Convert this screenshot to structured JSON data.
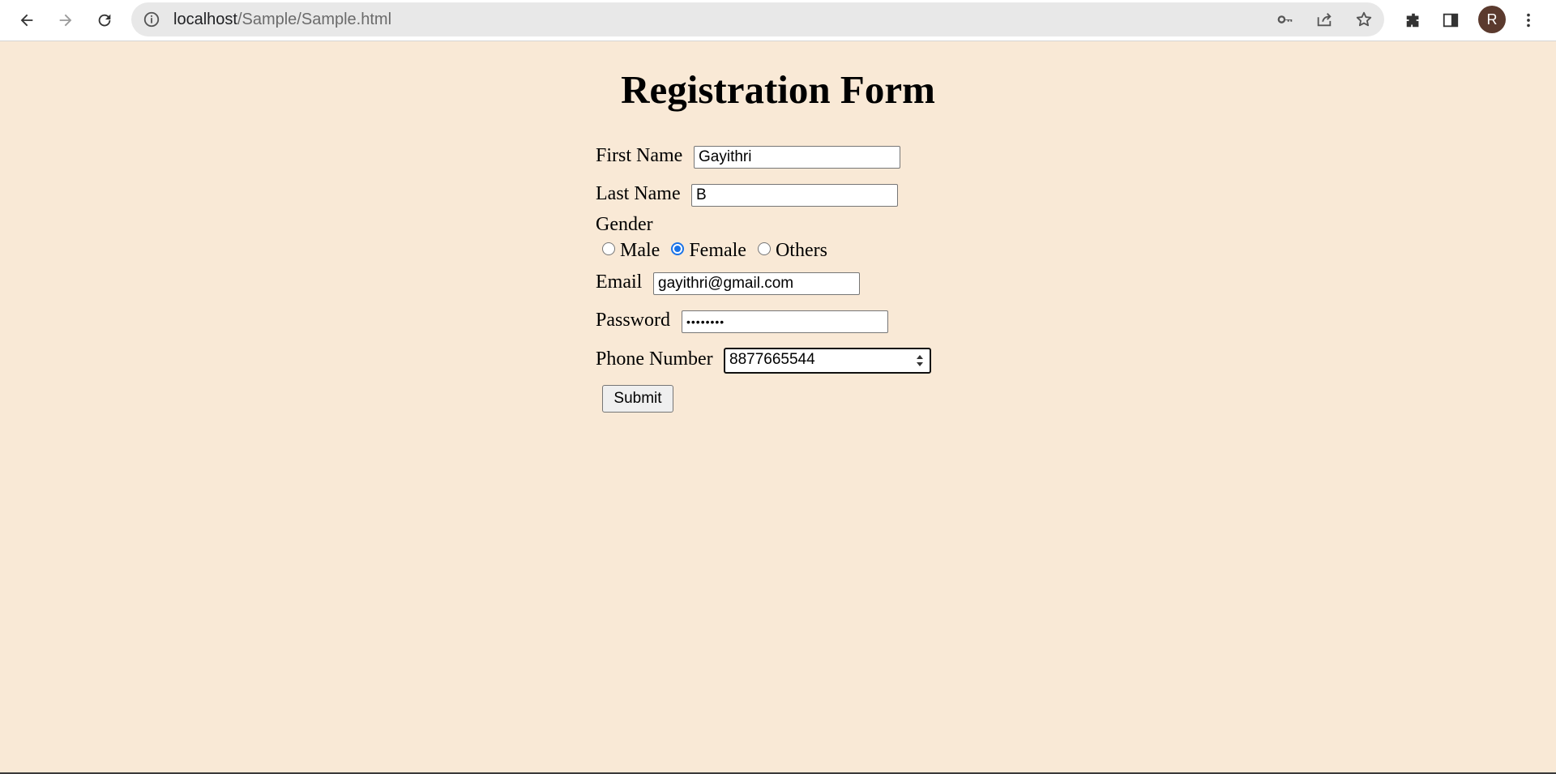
{
  "browser": {
    "url_host": "localhost",
    "url_path": "/Sample/Sample.html",
    "avatar_initial": "R",
    "icons": [
      "back-icon",
      "forward-icon",
      "reload-icon",
      "info-icon",
      "key-icon",
      "share-icon",
      "star-icon",
      "extensions-icon",
      "side-panel-icon",
      "menu-icon"
    ]
  },
  "page": {
    "title": "Registration Form",
    "background_color": "#f9e9d6"
  },
  "form": {
    "first_name_label": "First Name",
    "first_name_value": "Gayithri",
    "last_name_label": "Last Name",
    "last_name_value": "B",
    "gender_label": "Gender",
    "gender_options": [
      "Male",
      "Female",
      "Others"
    ],
    "gender_selected": "Female",
    "email_label": "Email",
    "email_value": "gayithri@gmail.com",
    "password_label": "Password",
    "password_value": "••••••••",
    "phone_label": "Phone Number",
    "phone_value": "8877665544",
    "submit_label": "Submit"
  },
  "colors": {
    "radio_checked": "#1a73e8"
  }
}
